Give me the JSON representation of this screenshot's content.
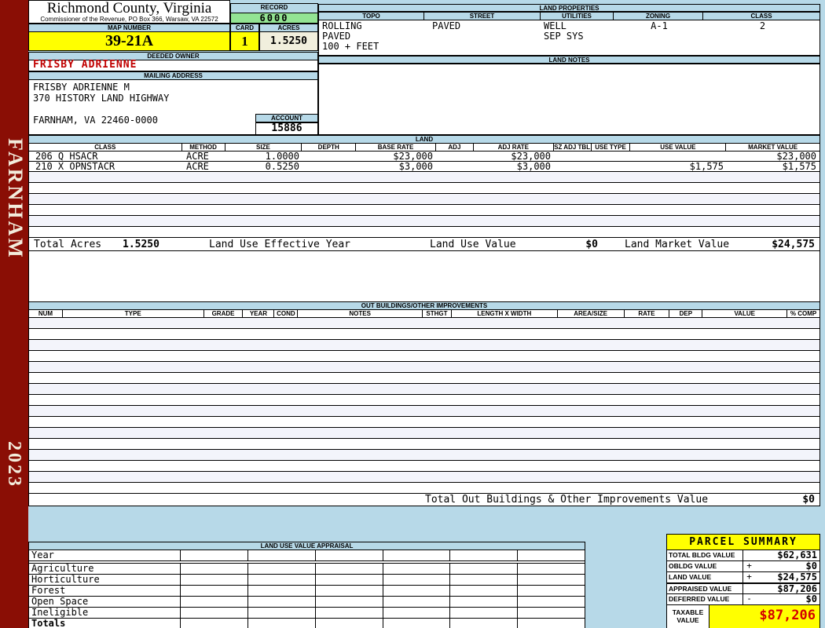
{
  "colors": {
    "sidebar_maroon": "#8a0e05",
    "header_blue": "#b7d9e8",
    "record_green": "#93e493",
    "highlight_yellow": "#ffff00",
    "acres_cream": "#f1efdd",
    "owner_red": "#c00000",
    "taxable_red": "#d40000"
  },
  "sidebar": {
    "district": "FARNHAM",
    "year": "2023"
  },
  "header": {
    "county": "Richmond County, Virginia",
    "commissioner_line": "Commissioner of the Revenue, PO Box 366, Warsaw, VA 22572",
    "record_label": "RECORD",
    "record_value": "6000",
    "map_number_label": "MAP NUMBER",
    "map_number": "39-21A",
    "card_label": "CARD",
    "card_value": "1",
    "acres_label": "ACRES",
    "acres_value": "1.5250"
  },
  "land_properties": {
    "title": "LAND PROPERTIES",
    "columns": [
      "TOPO",
      "STREET",
      "UTILITIES",
      "ZONING",
      "CLASS"
    ],
    "topo_lines": [
      "ROLLING",
      "PAVED",
      "100 + FEET"
    ],
    "street": "PAVED",
    "utilities_lines": [
      "WELL",
      "SEP SYS"
    ],
    "zoning": "A-1",
    "class": "2"
  },
  "owner": {
    "deeded_owner_label": "DEEDED OWNER",
    "deeded_owner": "FRISBY ADRIENNE",
    "mailing_address_label": "MAILING ADDRESS",
    "address_lines": [
      "FRISBY ADRIENNE M",
      "370 HISTORY LAND HIGHWAY",
      "",
      "FARNHAM, VA 22460-0000"
    ],
    "account_label": "ACCOUNT",
    "account_value": "15886"
  },
  "land_notes": {
    "title": "LAND NOTES"
  },
  "land": {
    "title": "LAND",
    "columns": [
      "CLASS",
      "METHOD",
      "SIZE",
      "DEPTH",
      "BASE RATE",
      "ADJ",
      "ADJ RATE",
      "SZ ADJ TBL",
      "USE TYPE",
      "USE VALUE",
      "MARKET VALUE"
    ],
    "rows": [
      {
        "class": "206 Q HSACR",
        "method": "ACRE",
        "size": "1.0000",
        "depth": "",
        "base_rate": "$23,000",
        "adj": "",
        "adj_rate": "$23,000",
        "sz_adj_tbl": "",
        "use_type": "",
        "use_value": "",
        "market_value": "$23,000"
      },
      {
        "class": "210 X OPNSTACR",
        "method": "ACRE",
        "size": "0.5250",
        "depth": "",
        "base_rate": "$3,000",
        "adj": "",
        "adj_rate": "$3,000",
        "sz_adj_tbl": "",
        "use_type": "",
        "use_value": "$1,575",
        "market_value": "$1,575"
      }
    ],
    "totals": {
      "acres_label": "Total Acres",
      "acres": "1.5250",
      "effective_year_label": "Land Use Effective Year",
      "use_value_label": "Land Use Value",
      "use_value": "$0",
      "market_value_label": "Land Market Value",
      "market_value": "$24,575"
    }
  },
  "out_buildings": {
    "title": "OUT BUILDINGS/OTHER IMPROVEMENTS",
    "columns": [
      "NUM",
      "TYPE",
      "GRADE",
      "YEAR",
      "COND",
      "NOTES",
      "STHGT",
      "LENGTH X WIDTH",
      "AREA/SIZE",
      "RATE",
      "DEP",
      "VALUE",
      "% COMP"
    ],
    "total_label": "Total Out Buildings & Other Improvements Value",
    "total_value": "$0"
  },
  "appraisal": {
    "title": "LAND USE VALUE APPRAISAL",
    "row_labels": [
      "Year",
      "Agriculture",
      "Horticulture",
      "Forest",
      "Open Space",
      "Ineligible",
      "Totals"
    ]
  },
  "parcel_summary": {
    "title": "PARCEL SUMMARY",
    "rows": [
      {
        "label": "TOTAL BLDG VALUE",
        "op": "",
        "value": "$62,631"
      },
      {
        "label": "OBLDG VALUE",
        "op": "+",
        "value": "$0"
      },
      {
        "label": "LAND VALUE",
        "op": "+",
        "value": "$24,575"
      },
      {
        "label": "APPRAISED VALUE",
        "op": "",
        "value": "$87,206"
      },
      {
        "label": "DEFERRED VALUE",
        "op": "-",
        "value": "$0"
      }
    ],
    "taxable_label": "TAXABLE VALUE",
    "taxable_value": "$87,206"
  }
}
